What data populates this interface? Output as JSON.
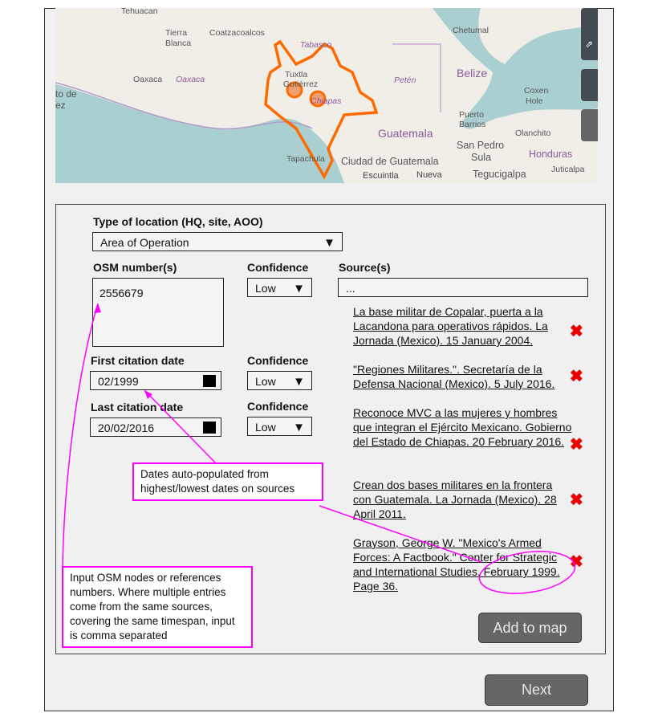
{
  "map": {
    "labels": [
      "Tehuacan",
      "Tierra",
      "Blanca",
      "Coatzacoalcos",
      "Tabasco",
      "Chetumal",
      "Oaxaca",
      "Oaxaca",
      "Tuxtla",
      "Gutiérrez",
      "Chiapas",
      "Petén",
      "Belize",
      "Coxen",
      "Hole",
      "Puerto",
      "Barrios",
      "Guatemala",
      "Olanchito",
      "San Pedro",
      "Sula",
      "Honduras",
      "Tapachula",
      "Ciudad de Guatemala",
      "Juticalpa",
      "Nueva",
      "Tegucigalpa",
      "Escuintla",
      "to de",
      "ez"
    ],
    "region_color": "#ff6a00"
  },
  "form": {
    "type_label": "Type of location (HQ, site, AOO)",
    "type_value": "Area of Operation",
    "osm_label": "OSM number(s)",
    "osm_value": "2556679",
    "confidence_label": "Confidence",
    "confidence_value": "Low",
    "sources_label": "Source(s)",
    "sources_value": "...",
    "first_label": "First citation date",
    "first_value": "02/1999",
    "last_label": "Last citation date",
    "last_value": "20/02/2016",
    "sources": [
      "La base militar de Copalar, puerta a la Lacandona para operativos rápidos. La Jornada (Mexico). 15 January 2004.",
      "\"Regiones Militares.\". Secretaría de la Defensa Nacional (Mexico). 5 July 2016.",
      "Reconoce MVC a las mujeres y hombres que integran el Ejército Mexicano. Gobierno del Estado de Chiapas. 20 February 2016.",
      "Crean dos bases militares en la frontera con Guatemala. La Jornada (Mexico). 28 April 2011.",
      "Grayson, George W. \"Mexico's Armed Forces: A Factbook.\" Center for Strategic and International Studies. February 1999. Page 36."
    ],
    "add_button": "Add to map"
  },
  "notes": {
    "dates": "Dates auto-populated from highest/lowest dates on sources",
    "osm": "Input OSM nodes or references numbers. Where multiple entries come from the same sources, covering the same timespan, input is comma separated"
  },
  "next_button": "Next",
  "annotation_color": "#ff00ff",
  "remove_color": "#e00000"
}
